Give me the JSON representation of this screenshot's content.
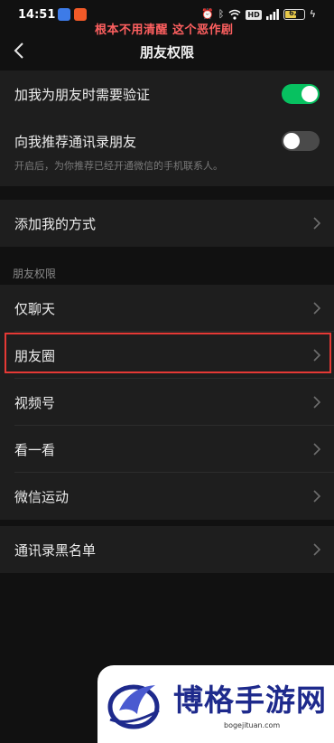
{
  "status_bar": {
    "time": "14:51",
    "hd_label": "HD",
    "battery_level": 62,
    "battery_text": "62"
  },
  "annotation": "根本不用清醒 这个恶作剧",
  "header": {
    "title": "朋友权限",
    "back_icon": "chevron-left-icon"
  },
  "section1": {
    "verify": {
      "label": "加我为朋友时需要验证",
      "toggle_on": true
    },
    "recommend": {
      "label": "向我推荐通讯录朋友",
      "toggle_on": false
    },
    "hint": "开启后，为你推荐已经开通微信的手机联系人。"
  },
  "section2": {
    "add_methods": {
      "label": "添加我的方式"
    }
  },
  "section3": {
    "header": "朋友权限",
    "items": [
      {
        "label": "仅聊天"
      },
      {
        "label": "朋友圈"
      },
      {
        "label": "视频号"
      },
      {
        "label": "看一看"
      },
      {
        "label": "微信运动"
      }
    ]
  },
  "section4": {
    "blacklist": {
      "label": "通讯录黑名单"
    }
  },
  "watermark": {
    "title": "博格手游网",
    "subtitle": "bogejituan.com"
  },
  "colors": {
    "toggle_on": "#07c160",
    "annotation": "#ff6060",
    "highlight": "#e53935",
    "watermark_brand": "#1e2a8c"
  }
}
